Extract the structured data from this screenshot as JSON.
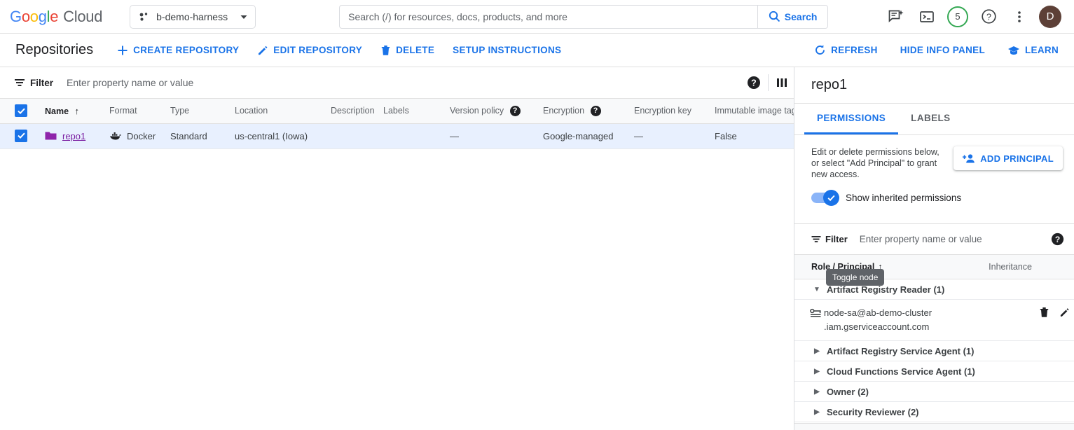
{
  "topbar": {
    "logo_text": "Google Cloud",
    "project": {
      "name": "b-demo-harness",
      "icon": "project-cluster-icon"
    },
    "search": {
      "placeholder": "Search (/) for resources, docs, products, and more",
      "value": "",
      "button_label": "Search"
    },
    "icons": [
      {
        "name": "gemini-chat-icon"
      },
      {
        "name": "cloud-shell-terminal-icon"
      },
      {
        "name": "help-icon"
      },
      {
        "name": "more-options-icon"
      }
    ],
    "credits_badge": "5",
    "avatar_initial": "D",
    "avatar_color": "#5d4037"
  },
  "actionbar": {
    "title": "Repositories",
    "buttons": [
      {
        "label": "CREATE REPOSITORY",
        "icon": "plus-icon"
      },
      {
        "label": "EDIT REPOSITORY",
        "icon": "pencil-icon"
      },
      {
        "label": "DELETE",
        "icon": "trash-icon"
      },
      {
        "label": "SETUP INSTRUCTIONS",
        "icon": "none"
      }
    ],
    "right_buttons": [
      {
        "label": "REFRESH",
        "icon": "refresh-icon"
      },
      {
        "label": "HIDE INFO PANEL",
        "icon": "none"
      },
      {
        "label": "LEARN",
        "icon": "graduation-cap-icon"
      }
    ]
  },
  "filterbar": {
    "label": "Filter",
    "placeholder": "Enter property name or value",
    "value": "",
    "help_icon": "help-icon",
    "columns_icon": "column-display-icon"
  },
  "table": {
    "columns": [
      {
        "label": "Name",
        "sorted": true,
        "sort_dir": "asc"
      },
      {
        "label": "Format"
      },
      {
        "label": "Type"
      },
      {
        "label": "Location"
      },
      {
        "label": "Description"
      },
      {
        "label": "Labels"
      },
      {
        "label": "Version policy",
        "help": true
      },
      {
        "label": "Encryption",
        "help": true
      },
      {
        "label": "Encryption key"
      },
      {
        "label": "Immutable image tags"
      }
    ],
    "rows": [
      {
        "selected": true,
        "name": "repo1",
        "name_icon": "folder-icon",
        "format": "Docker",
        "format_icon": "docker-whale-icon",
        "type": "Standard",
        "location": "us-central1 (Iowa)",
        "description": "",
        "labels": "",
        "version_policy": "—",
        "encryption": "Google-managed",
        "encryption_key": "—",
        "immutable_image_tags": "False"
      }
    ],
    "header_checkbox_checked": true
  },
  "infopanel": {
    "title": "repo1",
    "tabs": [
      {
        "label": "PERMISSIONS",
        "active": true
      },
      {
        "label": "LABELS",
        "active": false
      }
    ],
    "description": "Edit or delete permissions below, or select \"Add Principal\" to grant new access.",
    "add_principal_label": "ADD PRINCIPAL",
    "add_principal_icon": "person-add-icon",
    "show_inherited_label": "Show inherited permissions",
    "show_inherited_on": true,
    "filter": {
      "label": "Filter",
      "placeholder": "Enter property name or value",
      "value": "",
      "help_icon": "help-icon"
    },
    "perm_columns": {
      "role_principal": "Role / Principal",
      "inheritance": "Inheritance"
    },
    "tooltip": "Toggle node",
    "permissions": [
      {
        "role": "Artifact Registry Reader (1)",
        "expanded": true,
        "principals": [
          {
            "icon": "service-account-key-icon",
            "line1": "node-sa@ab-demo-cluster",
            "line2": ".iam.gserviceaccount.com",
            "inheritance": "",
            "actions": [
              "trash-icon",
              "pencil-icon"
            ]
          }
        ]
      },
      {
        "role": "Artifact Registry Service Agent (1)",
        "expanded": false,
        "principals": []
      },
      {
        "role": "Cloud Functions Service Agent (1)",
        "expanded": false,
        "principals": []
      },
      {
        "role": "Owner (2)",
        "expanded": false,
        "principals": []
      },
      {
        "role": "Security Reviewer (2)",
        "expanded": false,
        "principals": []
      }
    ]
  },
  "colors": {
    "accent_blue": "#1a73e8",
    "selected_row": "#e8f0fe",
    "visited_purple": "#7b1fa2",
    "green_badge": "#34a853",
    "header_gray": "#f8f9fa"
  }
}
